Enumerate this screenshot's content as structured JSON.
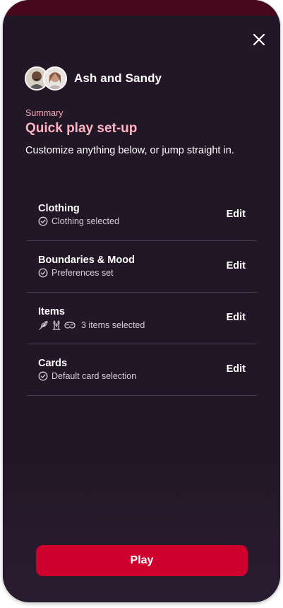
{
  "header": {
    "players": "Ash and Sandy",
    "avatars": [
      "avatar-ash",
      "avatar-sandy"
    ],
    "close_icon": "close-icon"
  },
  "summary": {
    "eyebrow": "Summary",
    "title": "Quick play set-up",
    "description": "Customize anything below, or jump straight in."
  },
  "settings": [
    {
      "title": "Clothing",
      "status": "Clothing selected",
      "status_icon": "check-circle-icon",
      "edit": "Edit"
    },
    {
      "title": "Boundaries & Mood",
      "status": "Preferences set",
      "status_icon": "check-circle-icon",
      "edit": "Edit"
    },
    {
      "title": "Items",
      "status": "3 items selected",
      "status_icons": [
        "feather-icon",
        "candle-icon",
        "mask-icon"
      ],
      "edit": "Edit"
    },
    {
      "title": "Cards",
      "status": "Default card selection",
      "status_icon": "check-circle-icon",
      "edit": "Edit"
    }
  ],
  "actions": {
    "play": "Play"
  },
  "colors": {
    "background": "#211726",
    "top_band": "#47081e",
    "accent": "#ffb3c1",
    "play_button": "#d0002e",
    "divider": "#4a3d50"
  }
}
